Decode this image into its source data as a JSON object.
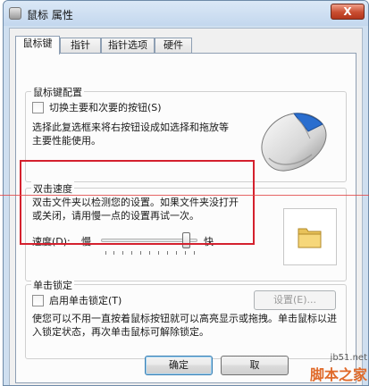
{
  "window": {
    "title": "鼠标 属性",
    "close_glyph": "X"
  },
  "tabs": [
    {
      "label": "鼠标键",
      "active": true
    },
    {
      "label": "指针",
      "active": false
    },
    {
      "label": "指针选项",
      "active": false
    },
    {
      "label": "硬件",
      "active": false
    }
  ],
  "button_config": {
    "group_title": "鼠标键配置",
    "switch_label": "切换主要和次要的按钮(S)",
    "switch_checked": false,
    "description": "选择此复选框来将右按钮设成如选择和拖放等主要性能使用。"
  },
  "double_click": {
    "group_title": "双击速度",
    "description": "双击文件夹以检测您的设置。如果文件夹没打开或关闭，请用慢一点的设置再试一次。",
    "speed_label": "速度(D):",
    "slow_label": "慢",
    "fast_label": "快",
    "speed_fraction": 0.92
  },
  "click_lock": {
    "group_title": "单击锁定",
    "enable_label": "启用单击锁定(T)",
    "enable_checked": false,
    "settings_button": "设置(E)...",
    "description": "使您可以不用一直按着鼠标按钮就可以高亮显示或拖拽。单击鼠标以进入锁定状态，再次单击鼠标可解除锁定。"
  },
  "footer": {
    "ok_button": "确定",
    "cancel_button": "取"
  },
  "watermark": {
    "url": "jb51.net",
    "name": "脚本之家"
  },
  "colors": {
    "highlight_box": "#d4212e",
    "accent_blue": "#2a6ecf"
  }
}
